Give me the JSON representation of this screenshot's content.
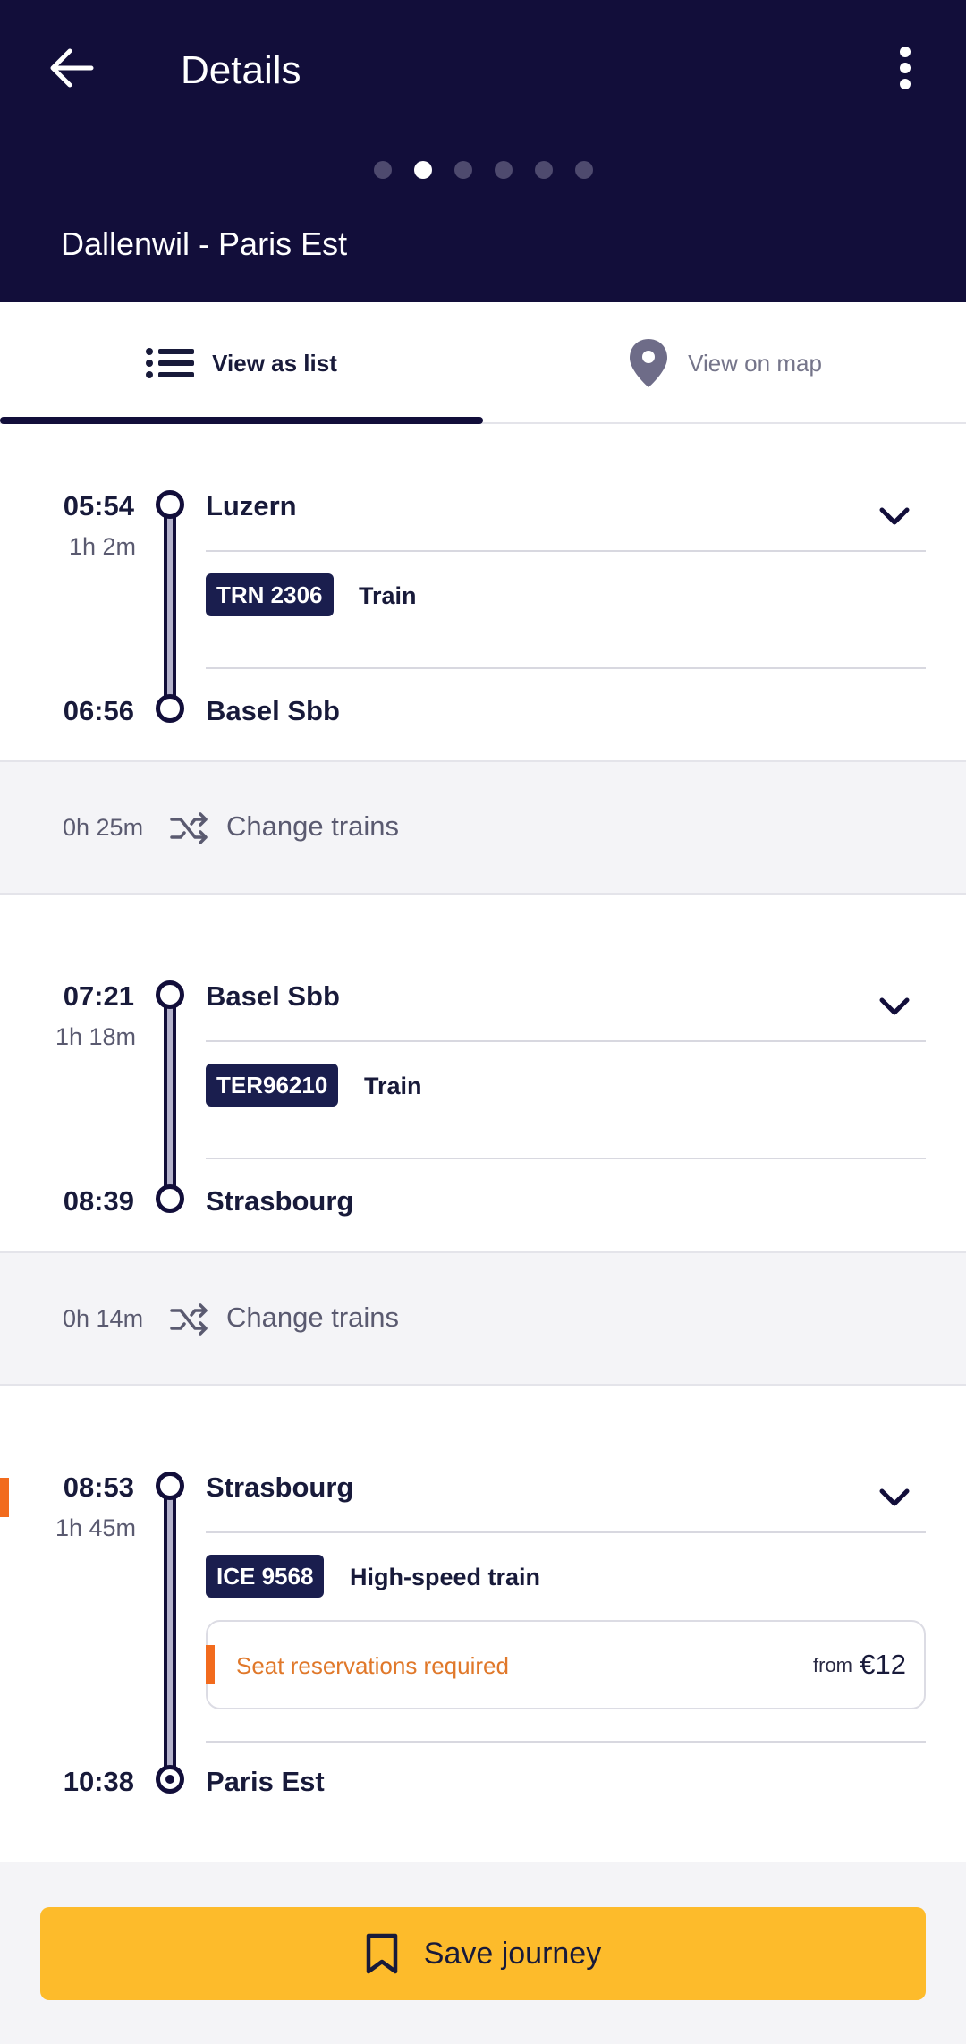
{
  "header": {
    "title": "Details",
    "route": "Dallenwil - Paris Est",
    "pager_total": 6,
    "pager_active": 2
  },
  "tabs": [
    {
      "label": "View as list",
      "icon": "list-icon",
      "selected": true
    },
    {
      "label": "View on map",
      "icon": "map-pin-icon",
      "selected": false
    }
  ],
  "legs": [
    {
      "dep_time": "05:54",
      "duration": "1h  2m",
      "from": "Luzern",
      "train": "TRN 2306",
      "type": "Train",
      "arr_time": "06:56",
      "to": "Basel Sbb"
    },
    {
      "dep_time": "07:21",
      "duration": "1h 18m",
      "from": "Basel Sbb",
      "train": "TER96210",
      "type": "Train",
      "arr_time": "08:39",
      "to": "Strasbourg"
    },
    {
      "dep_time": "08:53",
      "duration": "1h 45m",
      "from": "Strasbourg",
      "train": "ICE 9568",
      "type": "High-speed train",
      "reservation": {
        "text": "Seat reservations required",
        "from_label": "from",
        "price": "€12"
      },
      "arr_time": "10:38",
      "to": "Paris Est"
    }
  ],
  "transfers": [
    {
      "duration": "0h 25m",
      "label": "Change trains"
    },
    {
      "duration": "0h 14m",
      "label": "Change trains"
    }
  ],
  "footer": {
    "save_label": "Save journey"
  },
  "colors": {
    "header_bg": "#120e3a",
    "accent": "#fdbb2b",
    "warning": "#f26b1d",
    "badge_bg": "#1a1e4e"
  }
}
